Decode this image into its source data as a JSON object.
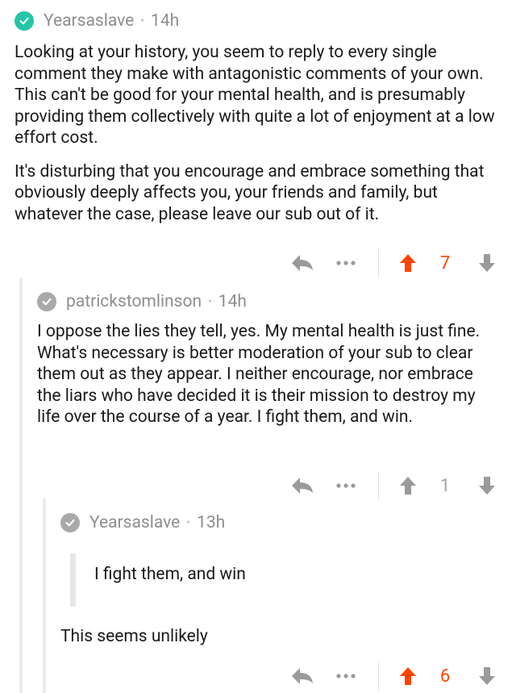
{
  "colors": {
    "accent": "#ff4500",
    "verified": "#24c6a5",
    "muted_check": "#a9a9a9",
    "icon_gray": "#9a9a9a",
    "score_gray": "#a5a5a5"
  },
  "comments": [
    {
      "author": "Yearsaslave",
      "time": "14h",
      "check_icon": "verified-check-icon",
      "paragraphs": [
        "Looking at your history, you seem to reply to every single comment they make with antagonistic comments of your own. This can't be good for your mental health, and is presumably providing them collectively with quite a lot of enjoyment at a low effort cost.",
        "It's disturbing that you encourage and embrace something that obviously deeply affects you, your friends and family, but whatever the case, please leave our sub out of it."
      ],
      "score": "7",
      "upvoted": true
    },
    {
      "author": "patrickstomlinson",
      "time": "14h",
      "check_icon": "check-icon",
      "paragraphs": [
        "I oppose the lies they tell, yes. My mental health is just fine. What's necessary is better moderation of your sub to clear them out as they appear. I neither encourage, nor embrace the liars who have decided it is their mission to destroy my life over the course of a year. I fight them, and win."
      ],
      "score": "1",
      "upvoted": false
    },
    {
      "author": "Yearsaslave",
      "time": "13h",
      "check_icon": "check-icon",
      "quote": "I fight them, and win",
      "paragraphs": [
        "This seems unlikely"
      ],
      "score": "6",
      "upvoted": true
    }
  ]
}
